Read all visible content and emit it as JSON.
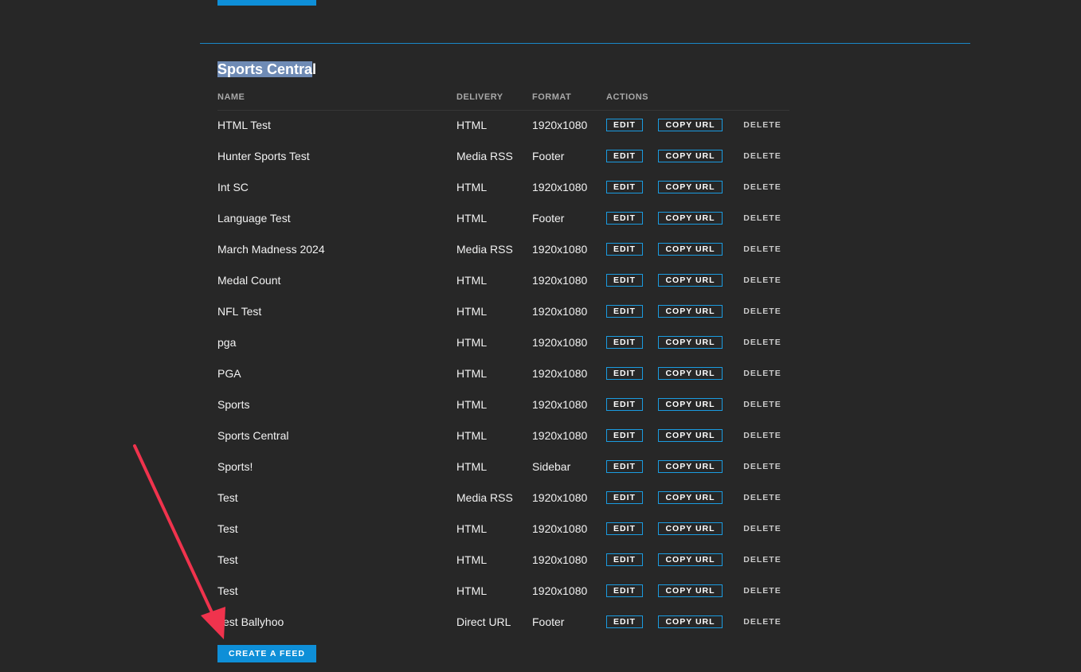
{
  "section": {
    "title_selected": "Sports Centra",
    "title_rest": "l"
  },
  "table": {
    "headers": {
      "name": "NAME",
      "delivery": "DELIVERY",
      "format": "FORMAT",
      "actions": "ACTIONS"
    },
    "actions": {
      "edit": "EDIT",
      "copy_url": "COPY URL",
      "delete": "DELETE"
    },
    "rows": [
      {
        "name": "HTML Test",
        "delivery": "HTML",
        "format": "1920x1080"
      },
      {
        "name": "Hunter Sports Test",
        "delivery": "Media RSS",
        "format": "Footer"
      },
      {
        "name": "Int SC",
        "delivery": "HTML",
        "format": "1920x1080"
      },
      {
        "name": "Language Test",
        "delivery": "HTML",
        "format": "Footer"
      },
      {
        "name": "March Madness 2024",
        "delivery": "Media RSS",
        "format": "1920x1080"
      },
      {
        "name": "Medal Count",
        "delivery": "HTML",
        "format": "1920x1080"
      },
      {
        "name": "NFL Test",
        "delivery": "HTML",
        "format": "1920x1080"
      },
      {
        "name": "pga",
        "delivery": "HTML",
        "format": "1920x1080"
      },
      {
        "name": "PGA",
        "delivery": "HTML",
        "format": "1920x1080"
      },
      {
        "name": "Sports",
        "delivery": "HTML",
        "format": "1920x1080"
      },
      {
        "name": "Sports Central",
        "delivery": "HTML",
        "format": "1920x1080"
      },
      {
        "name": "Sports!",
        "delivery": "HTML",
        "format": "Sidebar"
      },
      {
        "name": "Test",
        "delivery": "Media RSS",
        "format": "1920x1080"
      },
      {
        "name": "Test",
        "delivery": "HTML",
        "format": "1920x1080"
      },
      {
        "name": "Test",
        "delivery": "HTML",
        "format": "1920x1080"
      },
      {
        "name": "Test",
        "delivery": "HTML",
        "format": "1920x1080"
      },
      {
        "name": "Test Ballyhoo",
        "delivery": "Direct URL",
        "format": "Footer"
      }
    ]
  },
  "create_button": {
    "label": "CREATE A FEED"
  },
  "colors": {
    "background": "#272727",
    "accent": "#0e8fd8",
    "annotation_arrow": "#f0334d"
  }
}
